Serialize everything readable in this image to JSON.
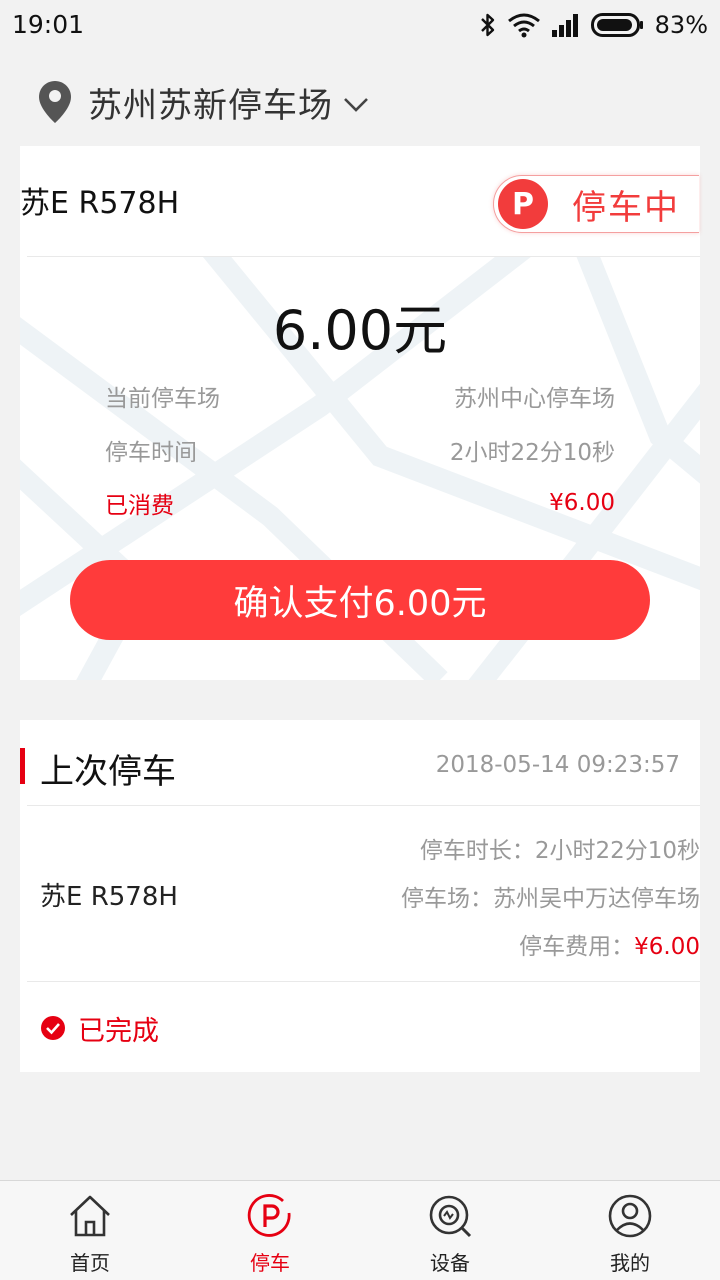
{
  "status_bar": {
    "time": "19:01",
    "battery": "83%"
  },
  "location": {
    "name": "苏州苏新停车场"
  },
  "current": {
    "plate": "苏E R578H",
    "badge_letter": "P",
    "status": "停车中",
    "amount": "6.00元",
    "rows": [
      {
        "label": "当前停车场",
        "value": "苏州中心停车场"
      },
      {
        "label": "停车时间",
        "value": "2小时22分10秒"
      },
      {
        "label": "已消费",
        "value": "¥6.00"
      }
    ],
    "pay_button": "确认支付6.00元"
  },
  "last": {
    "title": "上次停车",
    "datetime": "2018-05-14 09:23:57",
    "plate": "苏E R578H",
    "duration_label": "停车时长：",
    "duration": "2小时22分10秒",
    "lot_label": "停车场：",
    "lot": "苏州吴中万达停车场",
    "fee_label": "停车费用：",
    "fee": "¥6.00",
    "status": "已完成"
  },
  "nav": [
    {
      "label": "首页",
      "icon": "home-icon",
      "active": false
    },
    {
      "label": "停车",
      "icon": "parking-icon",
      "active": true
    },
    {
      "label": "设备",
      "icon": "device-icon",
      "active": false
    },
    {
      "label": "我的",
      "icon": "user-icon",
      "active": false
    }
  ],
  "colors": {
    "accent": "#e60012",
    "button": "#ff3b3b",
    "background": "#f2f2f2"
  }
}
